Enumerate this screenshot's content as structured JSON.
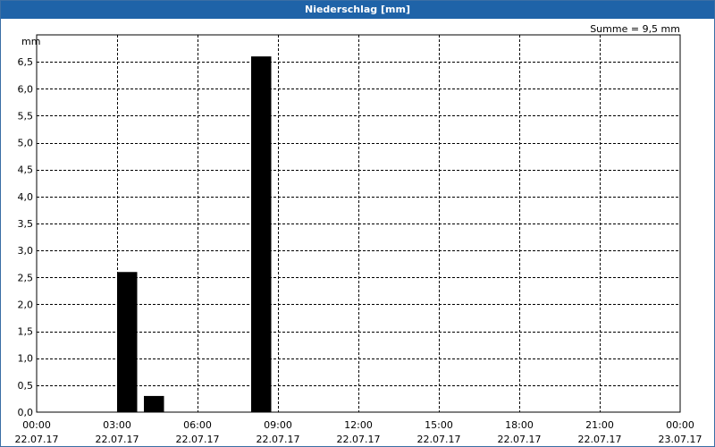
{
  "window": {
    "title": "Niederschlag [mm]"
  },
  "chart_data": {
    "type": "bar",
    "title": "Niederschlag [mm]",
    "ylabel": "mm",
    "annotation": "Summe = 9,5 mm",
    "ylim": [
      0,
      7
    ],
    "yticks": [
      "0,0",
      "0,5",
      "1,0",
      "1,5",
      "2,0",
      "2,5",
      "3,0",
      "3,5",
      "4,0",
      "4,5",
      "5,0",
      "5,5",
      "6,0",
      "6,5"
    ],
    "xrange_hours": [
      0,
      24
    ],
    "xticks": [
      {
        "time": "00:00",
        "date": "22.07.17"
      },
      {
        "time": "03:00",
        "date": "22.07.17"
      },
      {
        "time": "06:00",
        "date": "22.07.17"
      },
      {
        "time": "09:00",
        "date": "22.07.17"
      },
      {
        "time": "12:00",
        "date": "22.07.17"
      },
      {
        "time": "15:00",
        "date": "22.07.17"
      },
      {
        "time": "18:00",
        "date": "22.07.17"
      },
      {
        "time": "21:00",
        "date": "22.07.17"
      },
      {
        "time": "00:00",
        "date": "23.07.17"
      }
    ],
    "bars": [
      {
        "start_hour": 3.0,
        "end_hour": 3.75,
        "value": 2.6
      },
      {
        "start_hour": 4.0,
        "end_hour": 4.75,
        "value": 0.3
      },
      {
        "start_hour": 8.0,
        "end_hour": 8.75,
        "value": 6.6
      }
    ],
    "grid": true,
    "colors": {
      "bar": "#000000",
      "grid": "#000000",
      "titlebar": "#1f63a8"
    }
  }
}
